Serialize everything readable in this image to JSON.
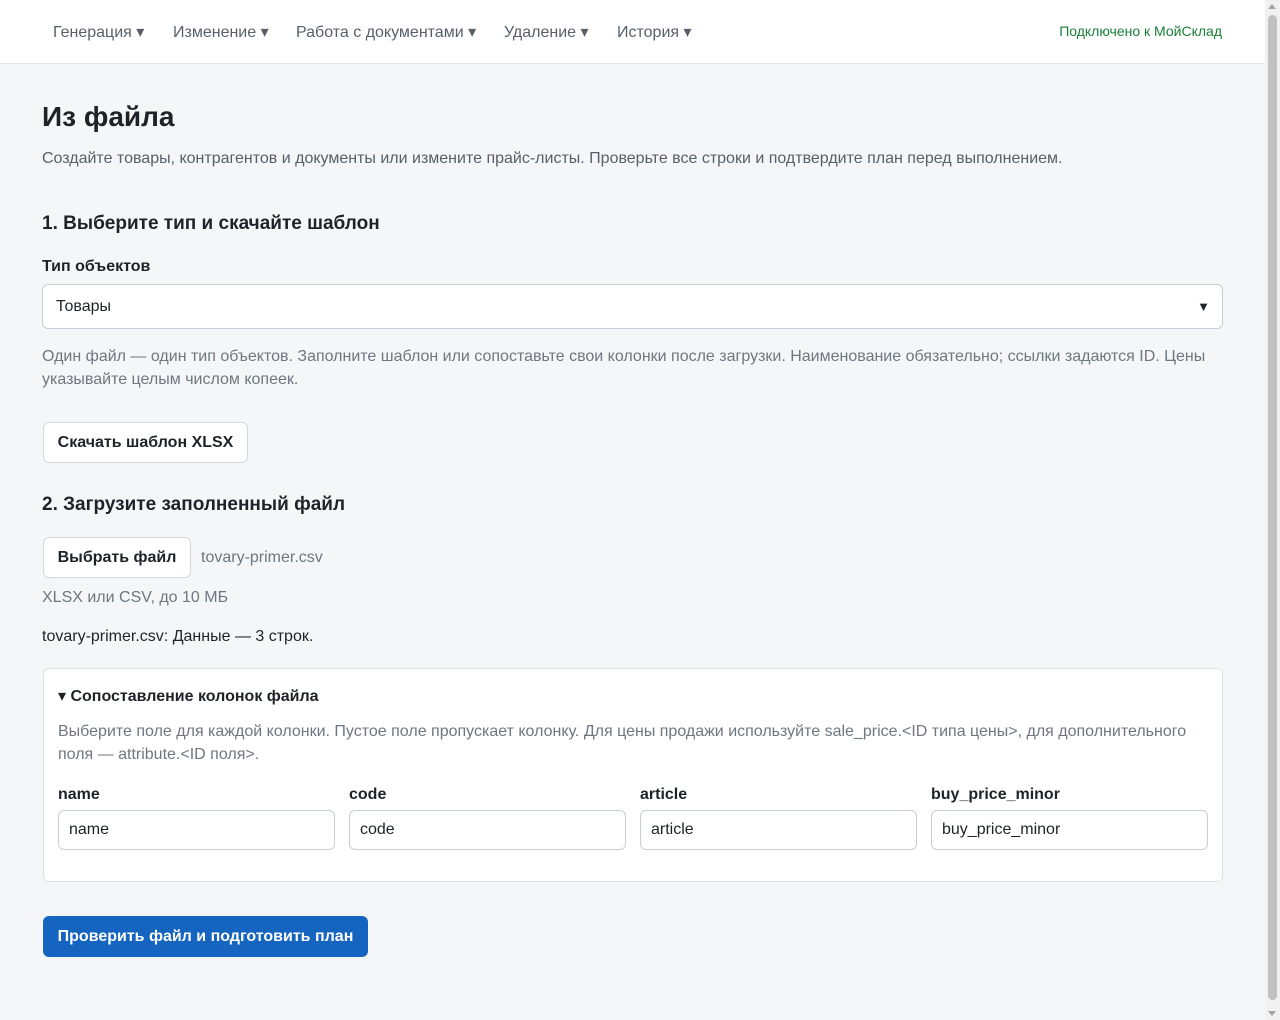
{
  "nav": {
    "items": [
      "Генерация ▾",
      "Изменение ▾",
      "Работа с документами ▾",
      "Удаление ▾",
      "История ▾"
    ],
    "status": "Подключено к МойСклад"
  },
  "page": {
    "title": "Из файла",
    "subtitle": "Создайте товары, контрагентов и документы или измените прайс-листы. Проверьте все строки и подтвердите план перед выполнением."
  },
  "step1": {
    "heading": "1. Выберите тип и скачайте шаблон",
    "type_label": "Тип объектов",
    "type_value": "Товары",
    "hint": "Один файл — один тип объектов. Заполните шаблон или сопоставьте свои колонки после загрузки. Наименование обязательно; ссылки задаются ID. Цены указывайте целым числом копеек.",
    "download_button": "Скачать шаблон XLSX"
  },
  "step2": {
    "heading": "2. Загрузите заполненный файл",
    "choose_button": "Выбрать файл",
    "file_name": "tovary-primer.csv",
    "file_hint": "XLSX или CSV, до 10 МБ",
    "file_status": "tovary-primer.csv: Данные — 3 строк."
  },
  "mapping": {
    "summary": "▾ Сопоставление колонок файла",
    "hint": "Выберите поле для каждой колонки. Пустое поле пропускает колонку. Для цены продажи используйте sale_price.<ID типа цены>, для дополнительного поля — attribute.<ID поля>.",
    "columns": [
      {
        "label": "name",
        "value": "name"
      },
      {
        "label": "code",
        "value": "code"
      },
      {
        "label": "article",
        "value": "article"
      },
      {
        "label": "buy_price_minor",
        "value": "buy_price_minor"
      }
    ]
  },
  "submit_button": "Проверить файл и подготовить план"
}
